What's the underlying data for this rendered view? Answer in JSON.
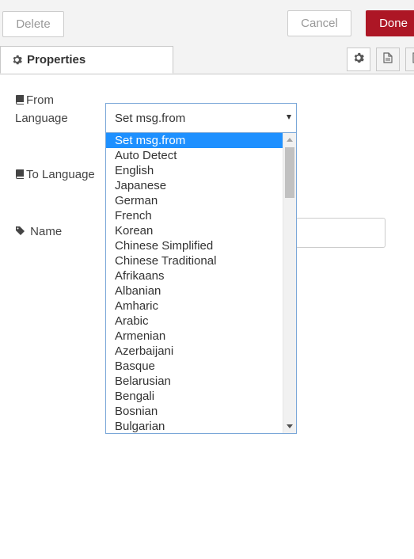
{
  "toolbar": {
    "delete_label": "Delete",
    "cancel_label": "Cancel",
    "done_label": "Done",
    "done_color": "#ad1625"
  },
  "tabs": {
    "properties_label": "Properties",
    "icons": [
      "gear-icon",
      "document-icon",
      "layout-icon"
    ]
  },
  "form": {
    "from_language_label": "From Language",
    "to_language_label": "To Language",
    "name_label": "Name",
    "from_language_value": "Set msg.from",
    "name_value": ""
  },
  "dropdown": {
    "selected": "Set msg.from",
    "options": [
      "Set msg.from",
      "Auto Detect",
      "English",
      "Japanese",
      "German",
      "French",
      "Korean",
      "Chinese Simplified",
      "Chinese Traditional",
      "Afrikaans",
      "Albanian",
      "Amharic",
      "Arabic",
      "Armenian",
      "Azerbaijani",
      "Basque",
      "Belarusian",
      "Bengali",
      "Bosnian",
      "Bulgarian"
    ],
    "highlight_color": "#1e90ff"
  }
}
